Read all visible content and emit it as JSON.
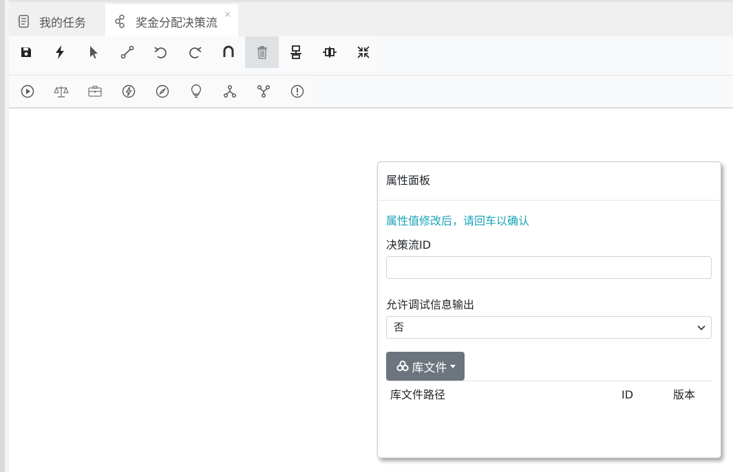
{
  "tabs": [
    {
      "label": "我的任务",
      "icon": "task-list-icon"
    },
    {
      "label": "奖金分配决策流",
      "icon": "flow-icon",
      "close": "×"
    }
  ],
  "toolbar_primary": [
    {
      "name": "save",
      "icon": "save-icon"
    },
    {
      "name": "bolt",
      "icon": "bolt-icon"
    },
    {
      "name": "pointer",
      "icon": "pointer-icon"
    },
    {
      "name": "connection",
      "icon": "connection-icon"
    },
    {
      "name": "undo",
      "icon": "undo-icon"
    },
    {
      "name": "redo",
      "icon": "redo-icon"
    },
    {
      "name": "magnet",
      "icon": "magnet-icon"
    },
    {
      "name": "delete",
      "icon": "trash-icon",
      "active": true
    },
    {
      "name": "align-vertical",
      "icon": "align-vertical-icon"
    },
    {
      "name": "align-horizontal",
      "icon": "align-horizontal-icon"
    },
    {
      "name": "compress",
      "icon": "compress-icon"
    }
  ],
  "toolbar_nodes": [
    {
      "name": "start",
      "icon": "play-circle-icon"
    },
    {
      "name": "rule",
      "icon": "scales-icon"
    },
    {
      "name": "package",
      "icon": "briefcase-icon"
    },
    {
      "name": "action",
      "icon": "bolt-circle-icon"
    },
    {
      "name": "script",
      "icon": "compass-icon"
    },
    {
      "name": "decision",
      "icon": "lightbulb-icon"
    },
    {
      "name": "fork",
      "icon": "fork-icon"
    },
    {
      "name": "join",
      "icon": "join-icon"
    },
    {
      "name": "end",
      "icon": "exclamation-circle-icon"
    }
  ],
  "panel": {
    "title": "属性面板",
    "hint": "属性值修改后，请回车以确认",
    "flow_id_label": "决策流ID",
    "flow_id_value": "",
    "debug_label": "允许调试信息输出",
    "debug_value": "否",
    "library_button": "库文件",
    "library_table_headers": [
      "库文件路径",
      "ID",
      "版本"
    ],
    "hint_color": "#17a2b8",
    "button_color": "#6c757d"
  }
}
